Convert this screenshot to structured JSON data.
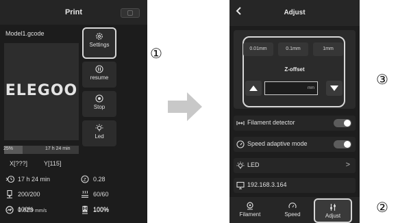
{
  "print_screen": {
    "title": "Print",
    "file_name": "Model1.gcode",
    "logo_text": "ELEGOO",
    "buttons": [
      {
        "label": "Settings",
        "icon": "gear-icon"
      },
      {
        "label": "resume",
        "icon": "resume-icon"
      },
      {
        "label": "Stop",
        "icon": "stop-icon"
      },
      {
        "label": "Led",
        "icon": "bulb-icon"
      }
    ],
    "progress": {
      "percent_label": "25%",
      "fraction": 0.25,
      "time_left": "17 h 24 min"
    },
    "coords": {
      "x": "X[???]",
      "y": "Y[115]"
    },
    "stats": {
      "time": "17 h 24 min",
      "z": "0.28",
      "nozzle": "200/200",
      "bed": "60/60",
      "speed": "100%",
      "fan": "100%",
      "flow_value": "0.023",
      "flow_unit": "mm/s",
      "extrude": "100%"
    }
  },
  "annotations": {
    "one": "①",
    "two": "②",
    "three": "③"
  },
  "adjust_screen": {
    "title": "Adjust",
    "steps": [
      "0.01mm",
      "0.1mm",
      "1mm"
    ],
    "z_offset_label": "Z-offset",
    "z_offset_unit": "mm",
    "rows": [
      {
        "label": "Filament detector",
        "toggle": true
      },
      {
        "label": "Speed adaptive mode",
        "toggle": true
      },
      {
        "label": "LED",
        "chevron": ">"
      },
      {
        "label": "192.168.3.164"
      }
    ],
    "tabs": [
      {
        "label": "Filament",
        "icon": "filament-icon"
      },
      {
        "label": "Speed",
        "icon": "speedometer-icon"
      },
      {
        "label": "Adjust",
        "icon": "adjust-icon",
        "active": true
      }
    ]
  },
  "colors": {
    "screen_bg": "#1c1c1c",
    "panel": "#2c2c2c",
    "highlight": "#d8d8d8",
    "arrow": "#c8c8c8"
  }
}
